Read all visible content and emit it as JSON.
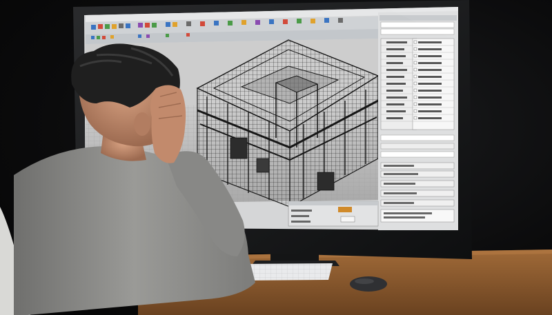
{
  "scene": {
    "description_hidden": "",
    "colors": {
      "background": "#0b0b0c",
      "monitor_bezel": "#121314",
      "screen_ui": "#d8d9da",
      "viewport_floor": "#bfbfbf",
      "desk": "#8a5a2e",
      "shirt": "#8d8d8b",
      "hair": "#222222",
      "skin": "#c89476",
      "accent_orange": "#d08a2a"
    }
  },
  "icons": [
    "toolbar-icons",
    "keyboard-icon",
    "mouse-icon"
  ],
  "screen": {
    "panel_title": "",
    "list_items": [],
    "buttons": []
  }
}
